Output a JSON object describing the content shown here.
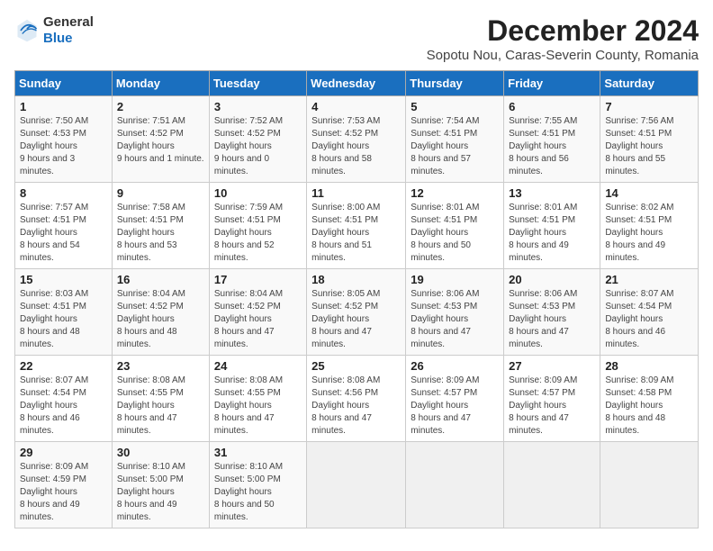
{
  "logo": {
    "general": "General",
    "blue": "Blue"
  },
  "title": "December 2024",
  "subtitle": "Sopotu Nou, Caras-Severin County, Romania",
  "weekdays": [
    "Sunday",
    "Monday",
    "Tuesday",
    "Wednesday",
    "Thursday",
    "Friday",
    "Saturday"
  ],
  "weeks": [
    [
      {
        "day": "1",
        "sunrise": "7:50 AM",
        "sunset": "4:53 PM",
        "daylight": "9 hours and 3 minutes."
      },
      {
        "day": "2",
        "sunrise": "7:51 AM",
        "sunset": "4:52 PM",
        "daylight": "9 hours and 1 minute."
      },
      {
        "day": "3",
        "sunrise": "7:52 AM",
        "sunset": "4:52 PM",
        "daylight": "9 hours and 0 minutes."
      },
      {
        "day": "4",
        "sunrise": "7:53 AM",
        "sunset": "4:52 PM",
        "daylight": "8 hours and 58 minutes."
      },
      {
        "day": "5",
        "sunrise": "7:54 AM",
        "sunset": "4:51 PM",
        "daylight": "8 hours and 57 minutes."
      },
      {
        "day": "6",
        "sunrise": "7:55 AM",
        "sunset": "4:51 PM",
        "daylight": "8 hours and 56 minutes."
      },
      {
        "day": "7",
        "sunrise": "7:56 AM",
        "sunset": "4:51 PM",
        "daylight": "8 hours and 55 minutes."
      }
    ],
    [
      {
        "day": "8",
        "sunrise": "7:57 AM",
        "sunset": "4:51 PM",
        "daylight": "8 hours and 54 minutes."
      },
      {
        "day": "9",
        "sunrise": "7:58 AM",
        "sunset": "4:51 PM",
        "daylight": "8 hours and 53 minutes."
      },
      {
        "day": "10",
        "sunrise": "7:59 AM",
        "sunset": "4:51 PM",
        "daylight": "8 hours and 52 minutes."
      },
      {
        "day": "11",
        "sunrise": "8:00 AM",
        "sunset": "4:51 PM",
        "daylight": "8 hours and 51 minutes."
      },
      {
        "day": "12",
        "sunrise": "8:01 AM",
        "sunset": "4:51 PM",
        "daylight": "8 hours and 50 minutes."
      },
      {
        "day": "13",
        "sunrise": "8:01 AM",
        "sunset": "4:51 PM",
        "daylight": "8 hours and 49 minutes."
      },
      {
        "day": "14",
        "sunrise": "8:02 AM",
        "sunset": "4:51 PM",
        "daylight": "8 hours and 49 minutes."
      }
    ],
    [
      {
        "day": "15",
        "sunrise": "8:03 AM",
        "sunset": "4:51 PM",
        "daylight": "8 hours and 48 minutes."
      },
      {
        "day": "16",
        "sunrise": "8:04 AM",
        "sunset": "4:52 PM",
        "daylight": "8 hours and 48 minutes."
      },
      {
        "day": "17",
        "sunrise": "8:04 AM",
        "sunset": "4:52 PM",
        "daylight": "8 hours and 47 minutes."
      },
      {
        "day": "18",
        "sunrise": "8:05 AM",
        "sunset": "4:52 PM",
        "daylight": "8 hours and 47 minutes."
      },
      {
        "day": "19",
        "sunrise": "8:06 AM",
        "sunset": "4:53 PM",
        "daylight": "8 hours and 47 minutes."
      },
      {
        "day": "20",
        "sunrise": "8:06 AM",
        "sunset": "4:53 PM",
        "daylight": "8 hours and 47 minutes."
      },
      {
        "day": "21",
        "sunrise": "8:07 AM",
        "sunset": "4:54 PM",
        "daylight": "8 hours and 46 minutes."
      }
    ],
    [
      {
        "day": "22",
        "sunrise": "8:07 AM",
        "sunset": "4:54 PM",
        "daylight": "8 hours and 46 minutes."
      },
      {
        "day": "23",
        "sunrise": "8:08 AM",
        "sunset": "4:55 PM",
        "daylight": "8 hours and 47 minutes."
      },
      {
        "day": "24",
        "sunrise": "8:08 AM",
        "sunset": "4:55 PM",
        "daylight": "8 hours and 47 minutes."
      },
      {
        "day": "25",
        "sunrise": "8:08 AM",
        "sunset": "4:56 PM",
        "daylight": "8 hours and 47 minutes."
      },
      {
        "day": "26",
        "sunrise": "8:09 AM",
        "sunset": "4:57 PM",
        "daylight": "8 hours and 47 minutes."
      },
      {
        "day": "27",
        "sunrise": "8:09 AM",
        "sunset": "4:57 PM",
        "daylight": "8 hours and 47 minutes."
      },
      {
        "day": "28",
        "sunrise": "8:09 AM",
        "sunset": "4:58 PM",
        "daylight": "8 hours and 48 minutes."
      }
    ],
    [
      {
        "day": "29",
        "sunrise": "8:09 AM",
        "sunset": "4:59 PM",
        "daylight": "8 hours and 49 minutes."
      },
      {
        "day": "30",
        "sunrise": "8:10 AM",
        "sunset": "5:00 PM",
        "daylight": "8 hours and 49 minutes."
      },
      {
        "day": "31",
        "sunrise": "8:10 AM",
        "sunset": "5:00 PM",
        "daylight": "8 hours and 50 minutes."
      },
      null,
      null,
      null,
      null
    ]
  ],
  "labels": {
    "sunrise": "Sunrise:",
    "sunset": "Sunset:",
    "daylight": "Daylight hours"
  }
}
